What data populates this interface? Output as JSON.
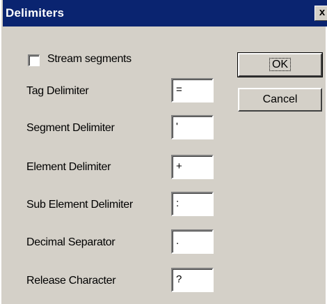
{
  "window": {
    "title": "Delimiters",
    "close_glyph": "x"
  },
  "checkbox": {
    "label": "Stream segments",
    "checked": false
  },
  "fields": [
    {
      "label": "Tag Delimiter",
      "value": "="
    },
    {
      "label": "Segment Delimiter",
      "value": "'"
    },
    {
      "label": "Element Delimiter",
      "value": "+"
    },
    {
      "label": "Sub Element Delimiter",
      "value": ":"
    },
    {
      "label": "Decimal Separator",
      "value": "."
    },
    {
      "label": "Release Character",
      "value": "?"
    }
  ],
  "buttons": {
    "ok_label": "OK",
    "cancel_label": "Cancel"
  },
  "colors": {
    "titlebar": "#0a2470",
    "dialog_face": "#d4d0c8"
  }
}
